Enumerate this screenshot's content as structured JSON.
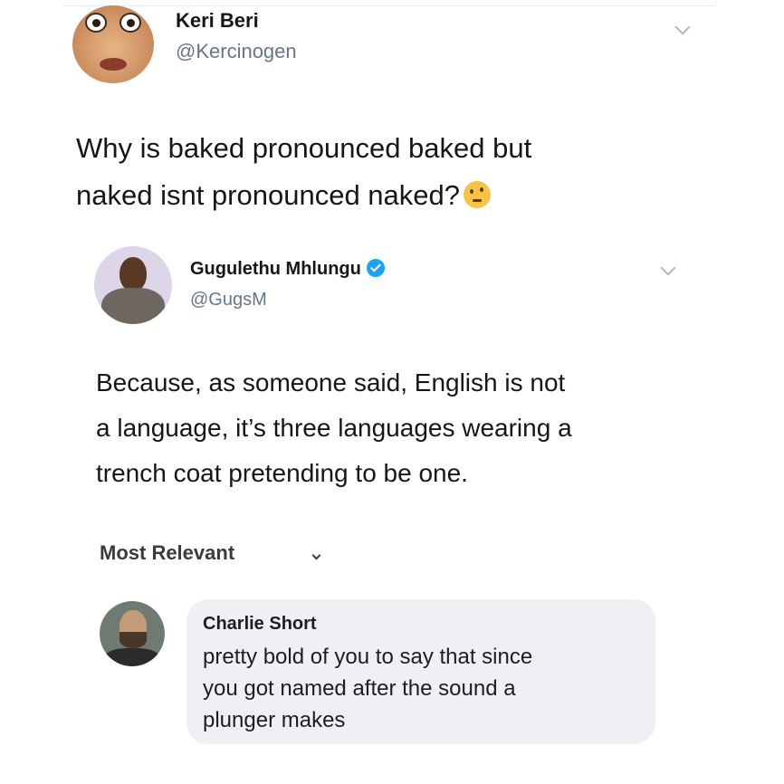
{
  "original_tweet": {
    "author_name": "Keri Beri",
    "handle": "@Kercinogen",
    "text_lines": [
      "Why is baked pronounced baked but",
      "naked isnt pronounced naked?"
    ],
    "emoji": "thinking-face-emoji"
  },
  "reply_tweet": {
    "author_name": "Gugulethu Mhlungu",
    "verified": true,
    "handle": "@GugsM",
    "text_lines": [
      "Because, as someone said, English is not",
      "a language, it’s three languages wearing a",
      "trench coat pretending to be one."
    ]
  },
  "comments": {
    "sort_label": "Most Relevant",
    "items": [
      {
        "author_name": "Charlie Short",
        "text_lines": [
          "pretty bold of you to say that since",
          "you got named after the sound a",
          "plunger makes"
        ]
      }
    ]
  },
  "colors": {
    "handle_gray": "#657786",
    "verified_blue": "#1da1f2",
    "comment_bubble": "#eef0f3"
  }
}
